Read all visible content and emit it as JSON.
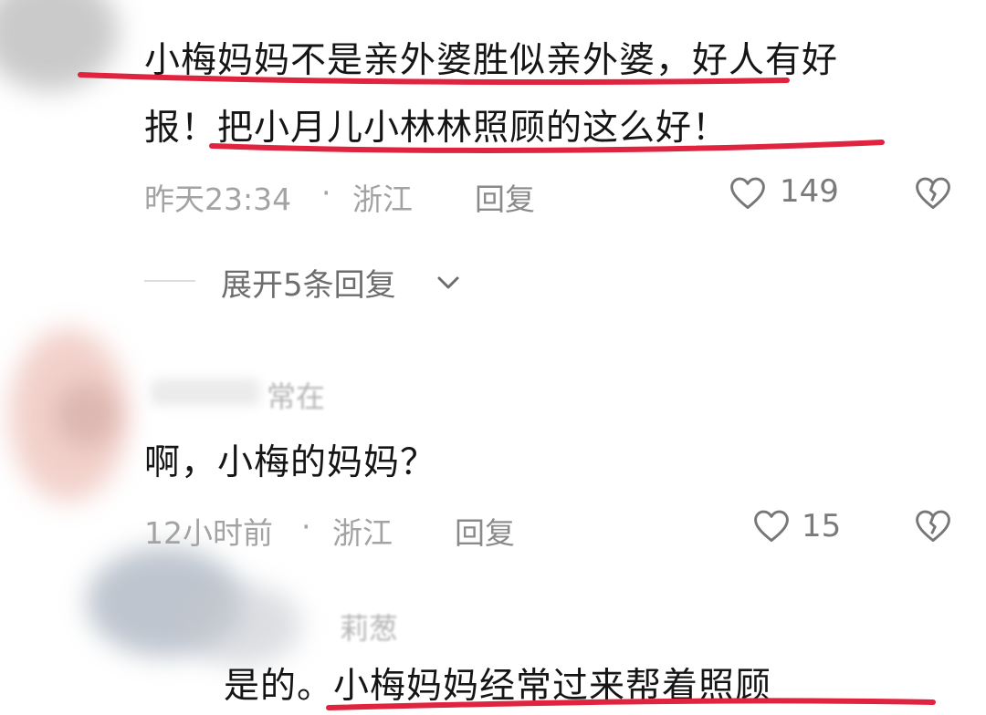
{
  "comments": [
    {
      "text_line1": "小梅妈妈不是亲外婆胜似亲外婆，好人有好",
      "text_line2": "报！把小月儿小林林照顾的这么好！",
      "time": "昨天23:34",
      "separator": "·",
      "location": "浙江",
      "reply_label": "回复",
      "likes": "149",
      "expand_label": "展开5条回复"
    },
    {
      "username": "常在",
      "text": "啊，小梅的妈妈？",
      "time": "12小时前",
      "separator": "·",
      "location": "浙江",
      "reply_label": "回复",
      "likes": "15"
    },
    {
      "username": "莉葱",
      "text": "是的。小梅妈妈经常过来帮着照顾"
    }
  ],
  "icons": {
    "like": "heart-outline-icon",
    "dislike": "broken-heart-icon",
    "expand": "chevron-down-icon"
  },
  "colors": {
    "annotation": "#e0233f",
    "meta_gray": "#a3a3a3"
  }
}
